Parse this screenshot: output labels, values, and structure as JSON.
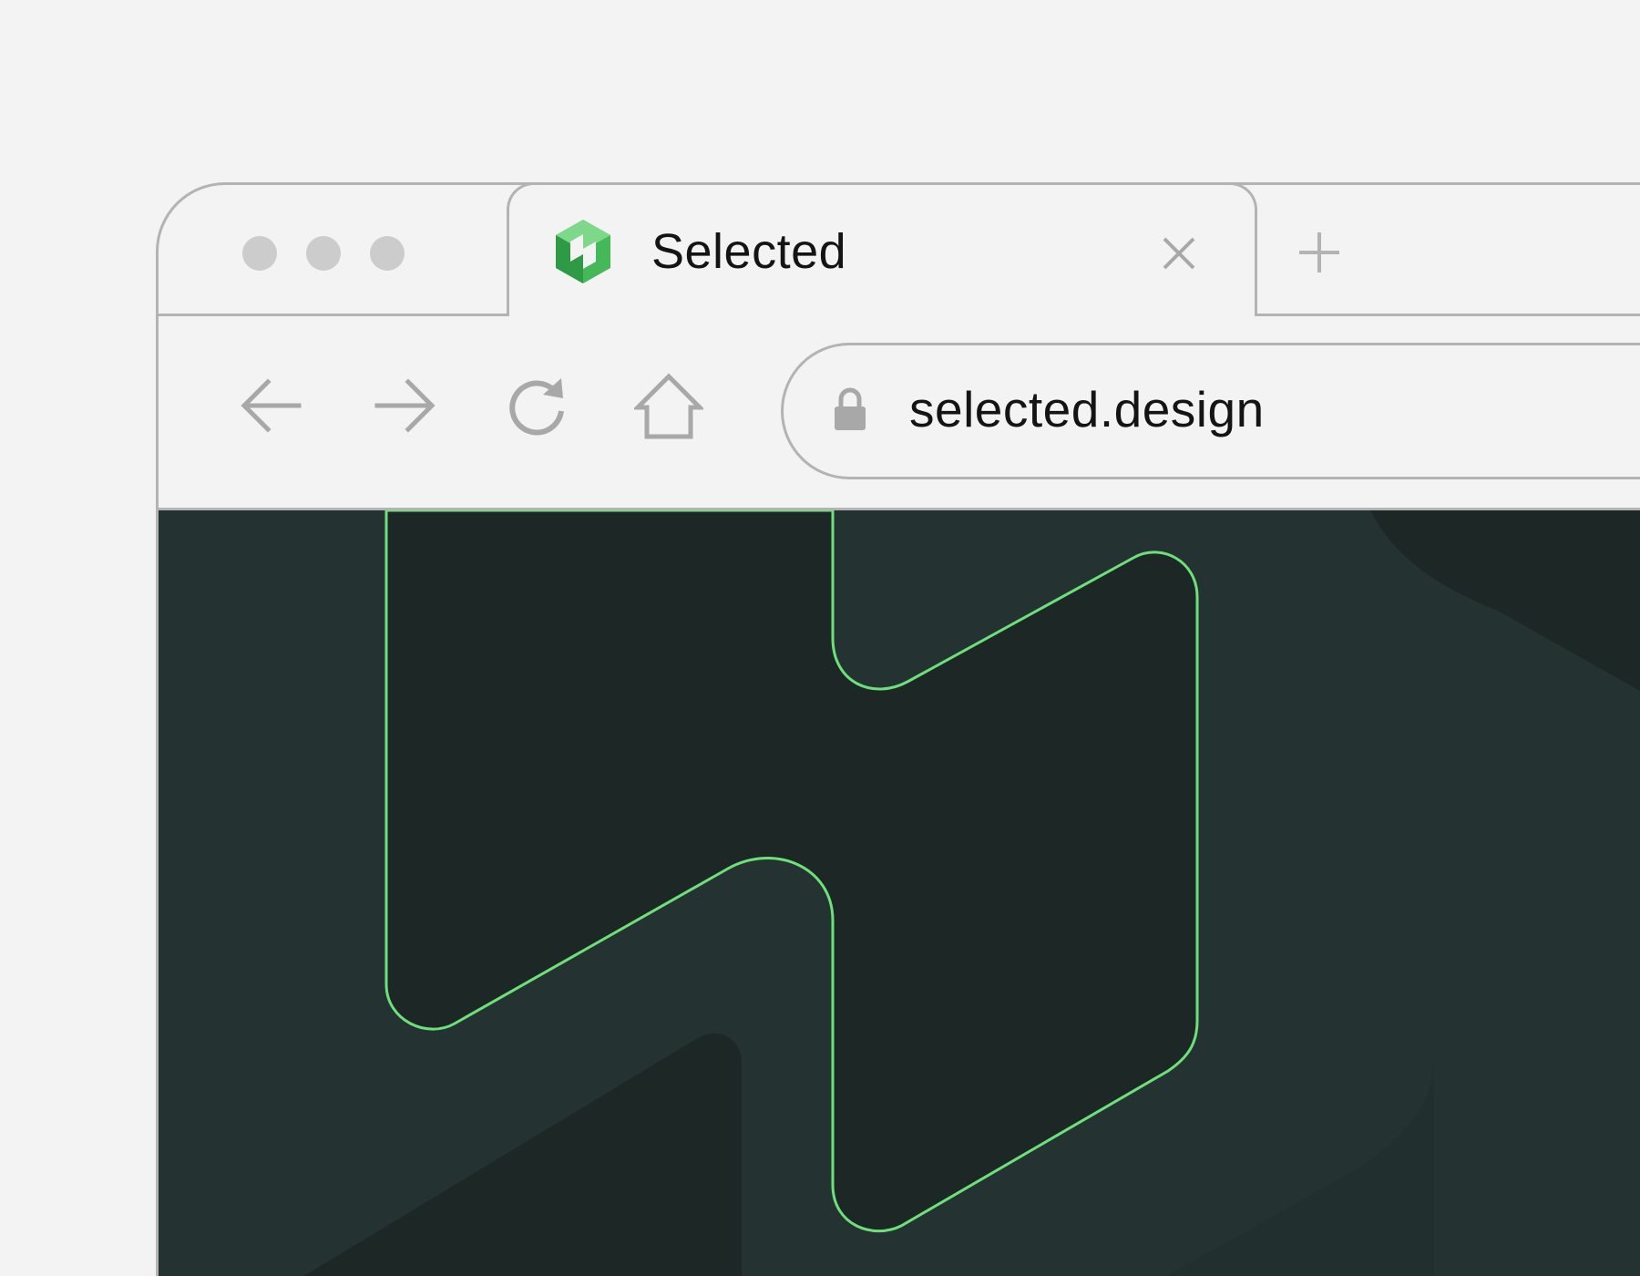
{
  "window_controls": [
    "dot-1",
    "dot-2",
    "dot-3"
  ],
  "tab": {
    "title": "Selected",
    "favicon": "selected-logo-icon",
    "close_icon": "close-icon"
  },
  "new_tab_icon": "plus-icon",
  "toolbar": {
    "back_icon": "arrow-left-icon",
    "forward_icon": "arrow-right-icon",
    "reload_icon": "reload-icon",
    "home_icon": "home-icon"
  },
  "address_bar": {
    "lock_icon": "lock-icon",
    "url": "selected.design"
  },
  "colors": {
    "page_background": "#f3f3f3",
    "chrome_border": "#b3b3b3",
    "icon_gray": "#a8a8a8",
    "content_background": "#243332",
    "content_shape_dark": "#1c2726",
    "accent_green": "#6ee07a",
    "logo_green": "#45b85a"
  }
}
